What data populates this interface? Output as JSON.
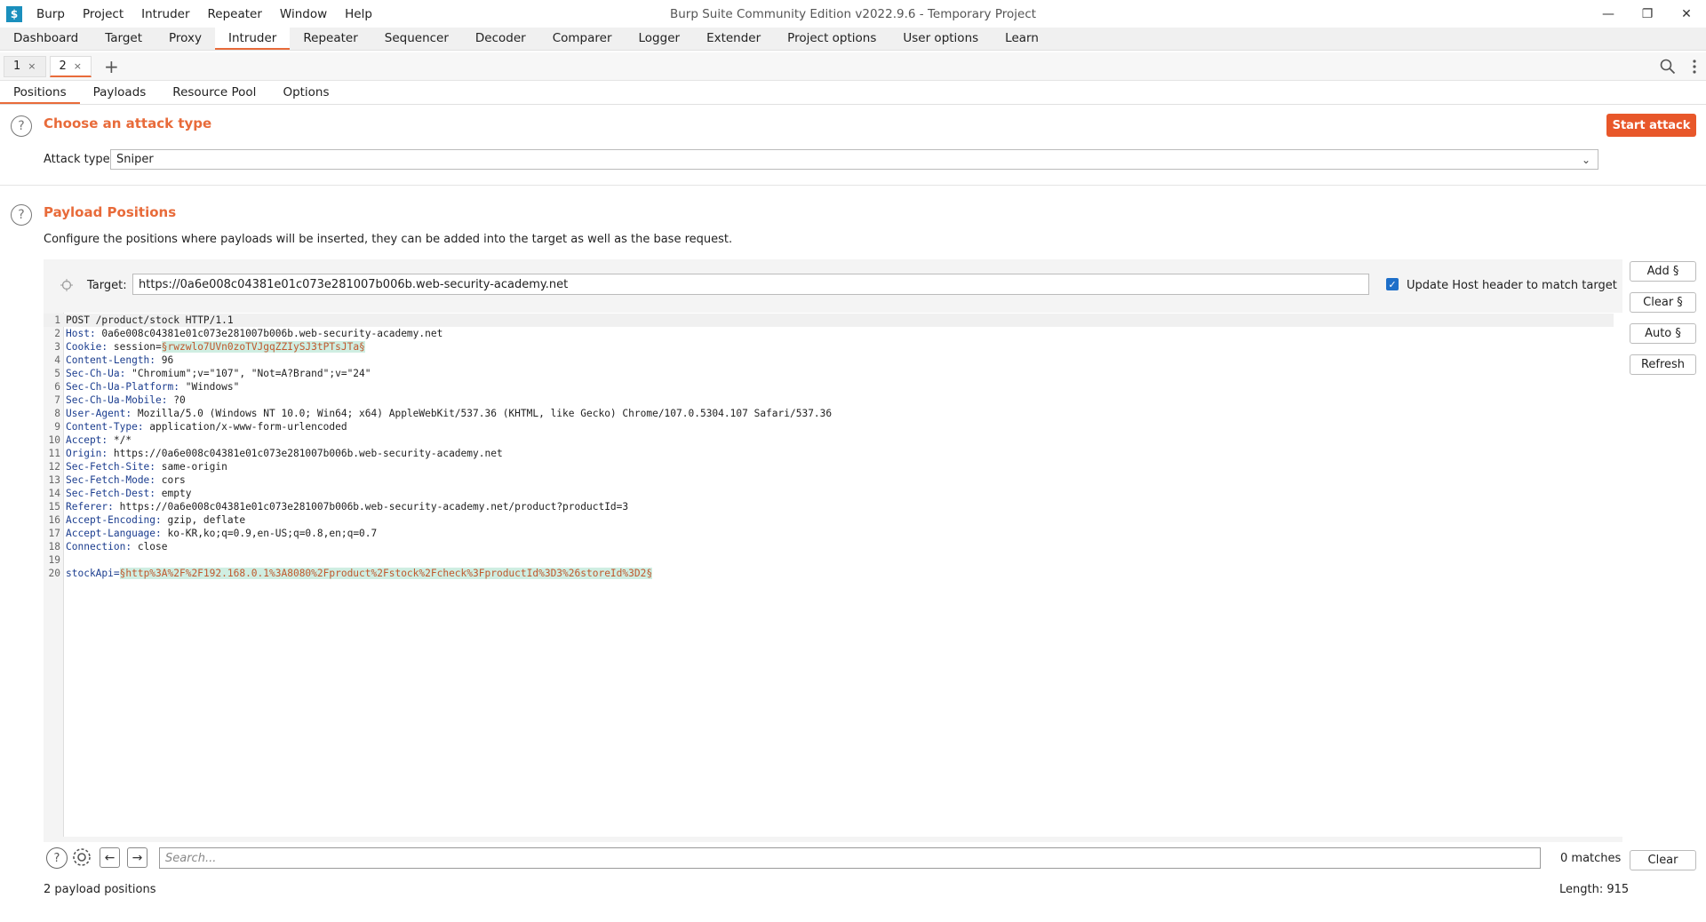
{
  "titlebar": {
    "menu": [
      "Burp",
      "Project",
      "Intruder",
      "Repeater",
      "Window",
      "Help"
    ],
    "window_title": "Burp Suite Community Edition v2022.9.6 - Temporary Project",
    "logo_char": "$"
  },
  "tool_tabs": [
    "Dashboard",
    "Target",
    "Proxy",
    "Intruder",
    "Repeater",
    "Sequencer",
    "Decoder",
    "Comparer",
    "Logger",
    "Extender",
    "Project options",
    "User options",
    "Learn"
  ],
  "tool_tabs_active": "Intruder",
  "attack_tabs": [
    {
      "label": "1",
      "close": "×"
    },
    {
      "label": "2",
      "close": "×"
    }
  ],
  "attack_tab_plus": "+",
  "sub_tabs": [
    "Positions",
    "Payloads",
    "Resource Pool",
    "Options"
  ],
  "sub_tabs_active": "Positions",
  "attack_type_section": {
    "help": "?",
    "title": "Choose an attack type",
    "start_button": "Start attack",
    "attack_type_label": "Attack type:",
    "attack_type_value": "Sniper"
  },
  "payload_positions": {
    "help": "?",
    "title": "Payload Positions",
    "description": "Configure the positions where payloads will be inserted, they can be added into the target as well as the base request.",
    "target_label": "Target:",
    "target_value": "https://0a6e008c04381e01c073e281007b006b.web-security-academy.net",
    "update_host_label": "Update Host header to match target",
    "buttons": {
      "add": "Add §",
      "clear": "Clear §",
      "auto": "Auto §",
      "refresh": "Refresh"
    }
  },
  "request_lines": [
    {
      "n": "1",
      "h": "",
      "v": "POST /product/stock HTTP/1.1",
      "m": ""
    },
    {
      "n": "2",
      "h": "Host:",
      "v": " 0a6e008c04381e01c073e281007b006b.web-security-academy.net",
      "m": ""
    },
    {
      "n": "3",
      "h": "Cookie:",
      "v": " session=",
      "m": "§rwzwlo7UVn0zoTVJgqZZIySJ3tPTsJTa§"
    },
    {
      "n": "4",
      "h": "Content-Length:",
      "v": " 96",
      "m": ""
    },
    {
      "n": "5",
      "h": "Sec-Ch-Ua:",
      "v": " \"Chromium\";v=\"107\", \"Not=A?Brand\";v=\"24\"",
      "m": ""
    },
    {
      "n": "6",
      "h": "Sec-Ch-Ua-Platform:",
      "v": " \"Windows\"",
      "m": ""
    },
    {
      "n": "7",
      "h": "Sec-Ch-Ua-Mobile:",
      "v": " ?0",
      "m": ""
    },
    {
      "n": "8",
      "h": "User-Agent:",
      "v": " Mozilla/5.0 (Windows NT 10.0; Win64; x64) AppleWebKit/537.36 (KHTML, like Gecko) Chrome/107.0.5304.107 Safari/537.36",
      "m": ""
    },
    {
      "n": "9",
      "h": "Content-Type:",
      "v": " application/x-www-form-urlencoded",
      "m": ""
    },
    {
      "n": "10",
      "h": "Accept:",
      "v": " */*",
      "m": ""
    },
    {
      "n": "11",
      "h": "Origin:",
      "v": " https://0a6e008c04381e01c073e281007b006b.web-security-academy.net",
      "m": ""
    },
    {
      "n": "12",
      "h": "Sec-Fetch-Site:",
      "v": " same-origin",
      "m": ""
    },
    {
      "n": "13",
      "h": "Sec-Fetch-Mode:",
      "v": " cors",
      "m": ""
    },
    {
      "n": "14",
      "h": "Sec-Fetch-Dest:",
      "v": " empty",
      "m": ""
    },
    {
      "n": "15",
      "h": "Referer:",
      "v": " https://0a6e008c04381e01c073e281007b006b.web-security-academy.net/product?productId=3",
      "m": ""
    },
    {
      "n": "16",
      "h": "Accept-Encoding:",
      "v": " gzip, deflate",
      "m": ""
    },
    {
      "n": "17",
      "h": "Accept-Language:",
      "v": " ko-KR,ko;q=0.9,en-US;q=0.8,en;q=0.7",
      "m": ""
    },
    {
      "n": "18",
      "h": "Connection:",
      "v": " close",
      "m": ""
    },
    {
      "n": "19",
      "h": "",
      "v": "",
      "m": ""
    },
    {
      "n": "20",
      "h": "stockApi=",
      "v": "",
      "m": "§http%3A%2F%2F192.168.0.1%3A8080%2Fproduct%2Fstock%2Fcheck%3FproductId%3D3%26storeId%3D2§"
    }
  ],
  "search": {
    "placeholder": "Search...",
    "matches": "0 matches",
    "clear": "Clear"
  },
  "footer": {
    "payload_count": "2 payload positions",
    "length": "Length: 915"
  },
  "colors": {
    "accent": "#e86b3a",
    "start_button": "#e8572a",
    "header_name": "#1b3d8f",
    "payload_marker_bg": "#cfeee2",
    "payload_marker_text": "#c0582d",
    "checkbox": "#1e6fc9"
  }
}
